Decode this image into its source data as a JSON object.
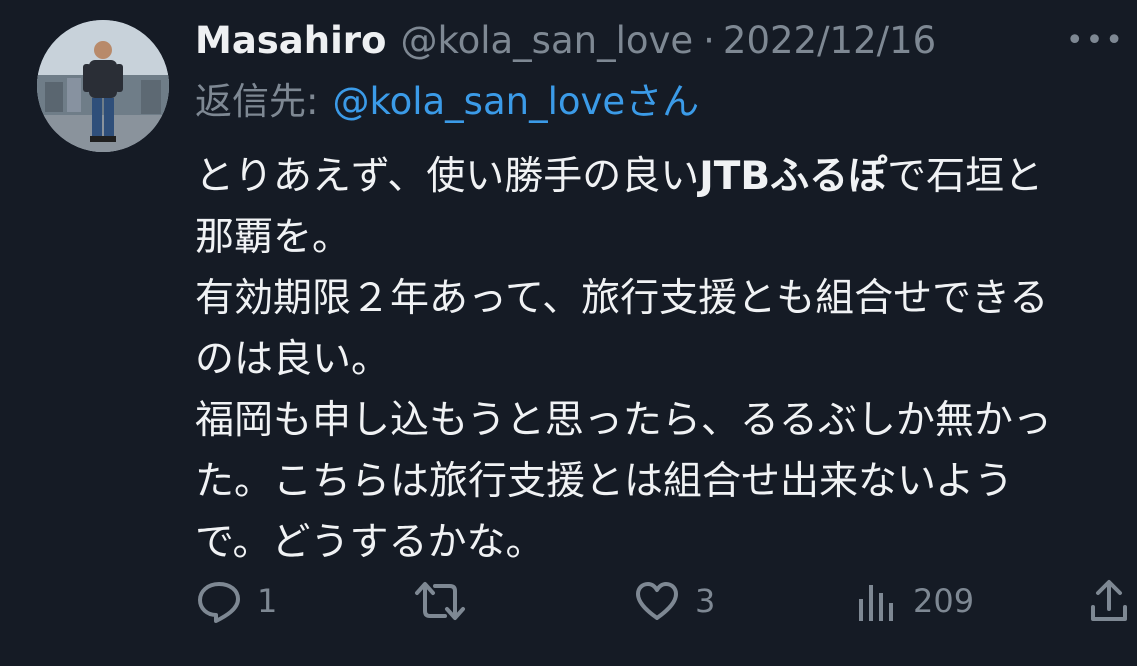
{
  "author": {
    "name": "Masahiro",
    "handle": "@kola_san_love",
    "separator": "·",
    "date": "2022/12/16"
  },
  "more_label": "•••",
  "reply": {
    "prefix": "返信先:",
    "handle": "@kola_san_love",
    "suffix": "さん"
  },
  "body": {
    "line1_before": "とりあえず、使い勝手の良い",
    "line1_bold": "JTBふるぽ",
    "line1_after": "で石垣と",
    "line2": "那覇を。",
    "line3": "有効期限２年あって、旅行支援とも組合せできる",
    "line4": "のは良い。",
    "line5": "福岡も申し込もうと思ったら、るるぶしか無かっ",
    "line6": "た。こちらは旅行支援とは組合せ出来ないよう",
    "line7": "で。どうするかな。"
  },
  "stats": {
    "replies": "1",
    "retweets": "",
    "likes": "3",
    "views": "209"
  },
  "icons": {
    "reply": "reply-icon",
    "retweet": "retweet-icon",
    "like": "heart-icon",
    "views": "views-icon",
    "share": "share-icon"
  },
  "colors": {
    "background": "#151b25",
    "primary_text": "#f0f2f4",
    "secondary_text": "#7e8893",
    "link": "#3b9be8"
  }
}
